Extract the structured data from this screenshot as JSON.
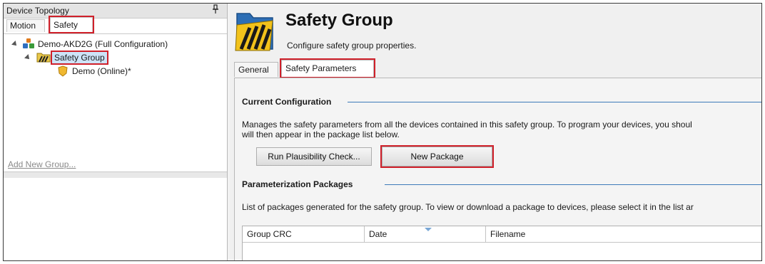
{
  "left_panel": {
    "title": "Device Topology",
    "pin_glyph": "⊥",
    "tabs": [
      {
        "label": "Motion",
        "active": false
      },
      {
        "label": "Safety",
        "active": true
      }
    ],
    "tree": [
      {
        "label": "Demo-AKD2G (Full Configuration)",
        "icon": "network-devices-icon"
      },
      {
        "label": "Safety Group",
        "icon": "safety-group-icon",
        "selected": true
      },
      {
        "label": "Demo (Online)*",
        "icon": "device-shield-icon"
      }
    ],
    "add_group_link": "Add New Group..."
  },
  "header": {
    "title": "Safety Group",
    "subtitle": "Configure safety group properties."
  },
  "tabs": [
    {
      "label": "General",
      "active": false
    },
    {
      "label": "Safety Parameters",
      "active": true
    }
  ],
  "current_configuration": {
    "heading": "Current Configuration",
    "description_line1": "Manages the safety parameters from all the devices contained in this safety group.  To program your devices, you shoul",
    "description_line2": "will then appear in the package list below.",
    "plausibility_button": "Run Plausibility Check...",
    "new_package_button": "New Package"
  },
  "packages": {
    "heading": "Parameterization Packages",
    "description": "List of packages generated for the safety group.  To view or download a package to devices, please select it in the list ar",
    "columns": [
      "Group CRC",
      "Date",
      "Filename"
    ]
  },
  "colors": {
    "highlight_box": "#d0202a",
    "section_line": "#3d7ab8"
  }
}
